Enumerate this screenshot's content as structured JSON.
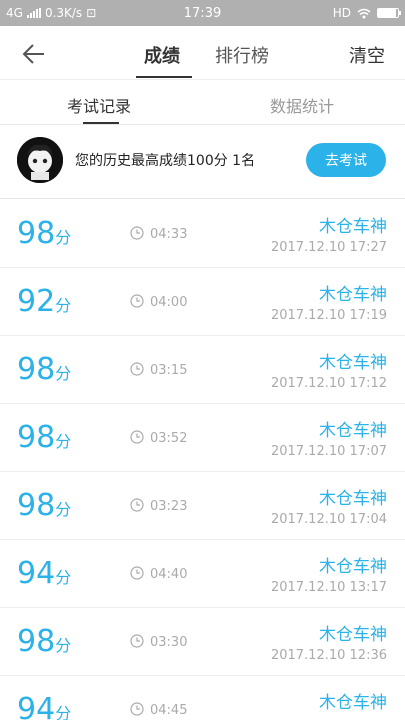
{
  "status": {
    "network": "4G",
    "speed": "0.3K/s",
    "time": "17:39",
    "hd": "HD"
  },
  "header": {
    "tabs": [
      {
        "label": "成绩",
        "active": true
      },
      {
        "label": "排行榜",
        "active": false
      }
    ],
    "right_action": "清空"
  },
  "subtabs": [
    {
      "label": "考试记录",
      "active": true
    },
    {
      "label": "数据统计",
      "active": false
    }
  ],
  "best": {
    "text": "您的历史最高成绩100分 1名",
    "button": "去考试"
  },
  "records": [
    {
      "score": "98",
      "unit": "分",
      "duration": "04:33",
      "name": "木仓车神",
      "date": "2017.12.10  17:27"
    },
    {
      "score": "92",
      "unit": "分",
      "duration": "04:00",
      "name": "木仓车神",
      "date": "2017.12.10  17:19"
    },
    {
      "score": "98",
      "unit": "分",
      "duration": "03:15",
      "name": "木仓车神",
      "date": "2017.12.10  17:12"
    },
    {
      "score": "98",
      "unit": "分",
      "duration": "03:52",
      "name": "木仓车神",
      "date": "2017.12.10  17:07"
    },
    {
      "score": "98",
      "unit": "分",
      "duration": "03:23",
      "name": "木仓车神",
      "date": "2017.12.10  17:04"
    },
    {
      "score": "94",
      "unit": "分",
      "duration": "04:40",
      "name": "木仓车神",
      "date": "2017.12.10  13:17"
    },
    {
      "score": "98",
      "unit": "分",
      "duration": "03:30",
      "name": "木仓车神",
      "date": "2017.12.10  12:36"
    },
    {
      "score": "94",
      "unit": "分",
      "duration": "04:45",
      "name": "木仓车神",
      "date": ""
    }
  ],
  "colors": {
    "accent": "#2bb2e8",
    "statusbar": "#b0b0b0"
  },
  "icons": [
    "back-arrow-icon",
    "clock-icon",
    "wifi-icon",
    "battery-icon",
    "signal-icon"
  ]
}
